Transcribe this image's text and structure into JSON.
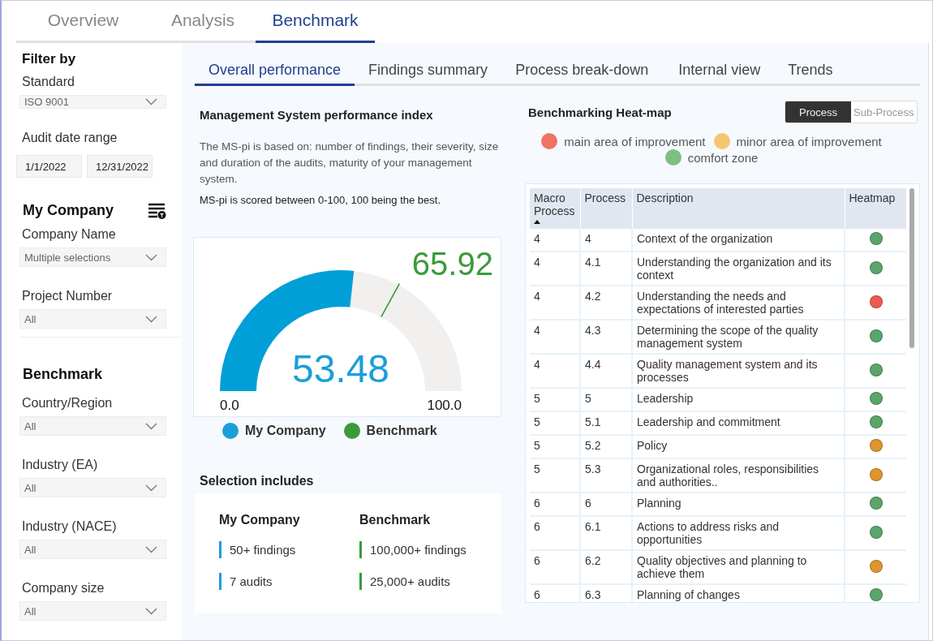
{
  "top_tabs": [
    {
      "label": "Overview",
      "selected": false
    },
    {
      "label": "Analysis",
      "selected": false
    },
    {
      "label": "Benchmark",
      "selected": true
    }
  ],
  "sidebar": {
    "title": "Filter by",
    "standard": {
      "label": "Standard",
      "value": "ISO 9001"
    },
    "date_range": {
      "label": "Audit date range",
      "from": "1/1/2022",
      "to": "12/31/2022"
    },
    "my_company": {
      "title": "My Company",
      "filters": [
        {
          "label": "Company Name",
          "value": "Multiple selections"
        },
        {
          "label": "Project Number",
          "value": "All"
        }
      ]
    },
    "benchmark": {
      "title": "Benchmark",
      "filters": [
        {
          "label": "Country/Region",
          "value": "All"
        },
        {
          "label": "Industry (EA)",
          "value": "All"
        },
        {
          "label": "Industry (NACE)",
          "value": "All"
        },
        {
          "label": "Company size",
          "value": "All"
        }
      ]
    }
  },
  "sub_tabs": [
    {
      "label": "Overall performance",
      "selected": true
    },
    {
      "label": "Findings summary",
      "selected": false
    },
    {
      "label": "Process break-down",
      "selected": false
    },
    {
      "label": "Internal view",
      "selected": false
    },
    {
      "label": "Trends",
      "selected": false
    }
  ],
  "performance": {
    "title": "Management System performance index",
    "description": "The MS-pi is based on: number of findings, their severity, size and duration of the audits, maturity of your management system.",
    "note": "MS-pi is scored between 0-100, 100 being the best.",
    "gauge": {
      "value": "53.48",
      "level": 0.5348,
      "min": "0.0",
      "max": "100.0",
      "benchmark": {
        "value": "65.92",
        "level": 0.6592
      }
    },
    "legend": [
      {
        "label": "My Company",
        "color": "#1a9fd8"
      },
      {
        "label": "Benchmark",
        "color": "#3a9b3a"
      }
    ],
    "selection": {
      "title": "Selection includes",
      "columns": [
        {
          "title": "My Company",
          "color": "#1a9fd8",
          "items": [
            "50+ findings",
            "7 audits"
          ]
        },
        {
          "title": "Benchmark",
          "color": "#3a9b3a",
          "items": [
            "100,000+ findings",
            "25,000+ audits"
          ]
        }
      ]
    }
  },
  "heatmap": {
    "title": "Benchmarking Heat-map",
    "toggle": [
      {
        "label": "Process",
        "selected": true
      },
      {
        "label": "Sub-Process",
        "selected": false
      }
    ],
    "legend": [
      {
        "label": "main area of improvement",
        "color": "#f07265"
      },
      {
        "label": "minor area of improvement",
        "color": "#f6c66e"
      },
      {
        "label": "comfort zone",
        "color": "#7dbe82"
      }
    ],
    "table": {
      "columns": [
        {
          "label": "Macro Process",
          "sorted": true
        },
        {
          "label": "Process",
          "sorted": false
        },
        {
          "label": "Description",
          "sorted": false
        },
        {
          "label": "Heatmap",
          "sorted": false
        }
      ],
      "rows": [
        {
          "macro": "4",
          "process": "4",
          "description": "Context of the organization",
          "color": "#5aa66a"
        },
        {
          "macro": "4",
          "process": "4.1",
          "description": "Understanding the organization and its context",
          "color": "#5aa66a"
        },
        {
          "macro": "4",
          "process": "4.2",
          "description": "Understanding the needs and expectations of interested parties",
          "color": "#ee5a52"
        },
        {
          "macro": "4",
          "process": "4.3",
          "description": "Determining the scope of the quality management system",
          "color": "#5aa66a"
        },
        {
          "macro": "4",
          "process": "4.4",
          "description": "Quality management system and its processes",
          "color": "#5aa66a"
        },
        {
          "macro": "5",
          "process": "5",
          "description": "Leadership",
          "color": "#5aa66a"
        },
        {
          "macro": "5",
          "process": "5.1",
          "description": "Leadership and commitment",
          "color": "#5aa66a"
        },
        {
          "macro": "5",
          "process": "5.2",
          "description": "Policy",
          "color": "#df962c"
        },
        {
          "macro": "5",
          "process": "5.3",
          "description": "Organizational roles, responsibilities and authorities..",
          "color": "#df962c"
        },
        {
          "macro": "6",
          "process": "6",
          "description": "Planning",
          "color": "#5aa66a"
        },
        {
          "macro": "6",
          "process": "6.1",
          "description": "Actions to address risks and opportunities",
          "color": "#5aa66a"
        },
        {
          "macro": "6",
          "process": "6.2",
          "description": "Quality objectives and planning to achieve them",
          "color": "#df962c"
        },
        {
          "macro": "6",
          "process": "6.3",
          "description": "Planning of changes",
          "color": "#5aa66a"
        }
      ]
    }
  }
}
